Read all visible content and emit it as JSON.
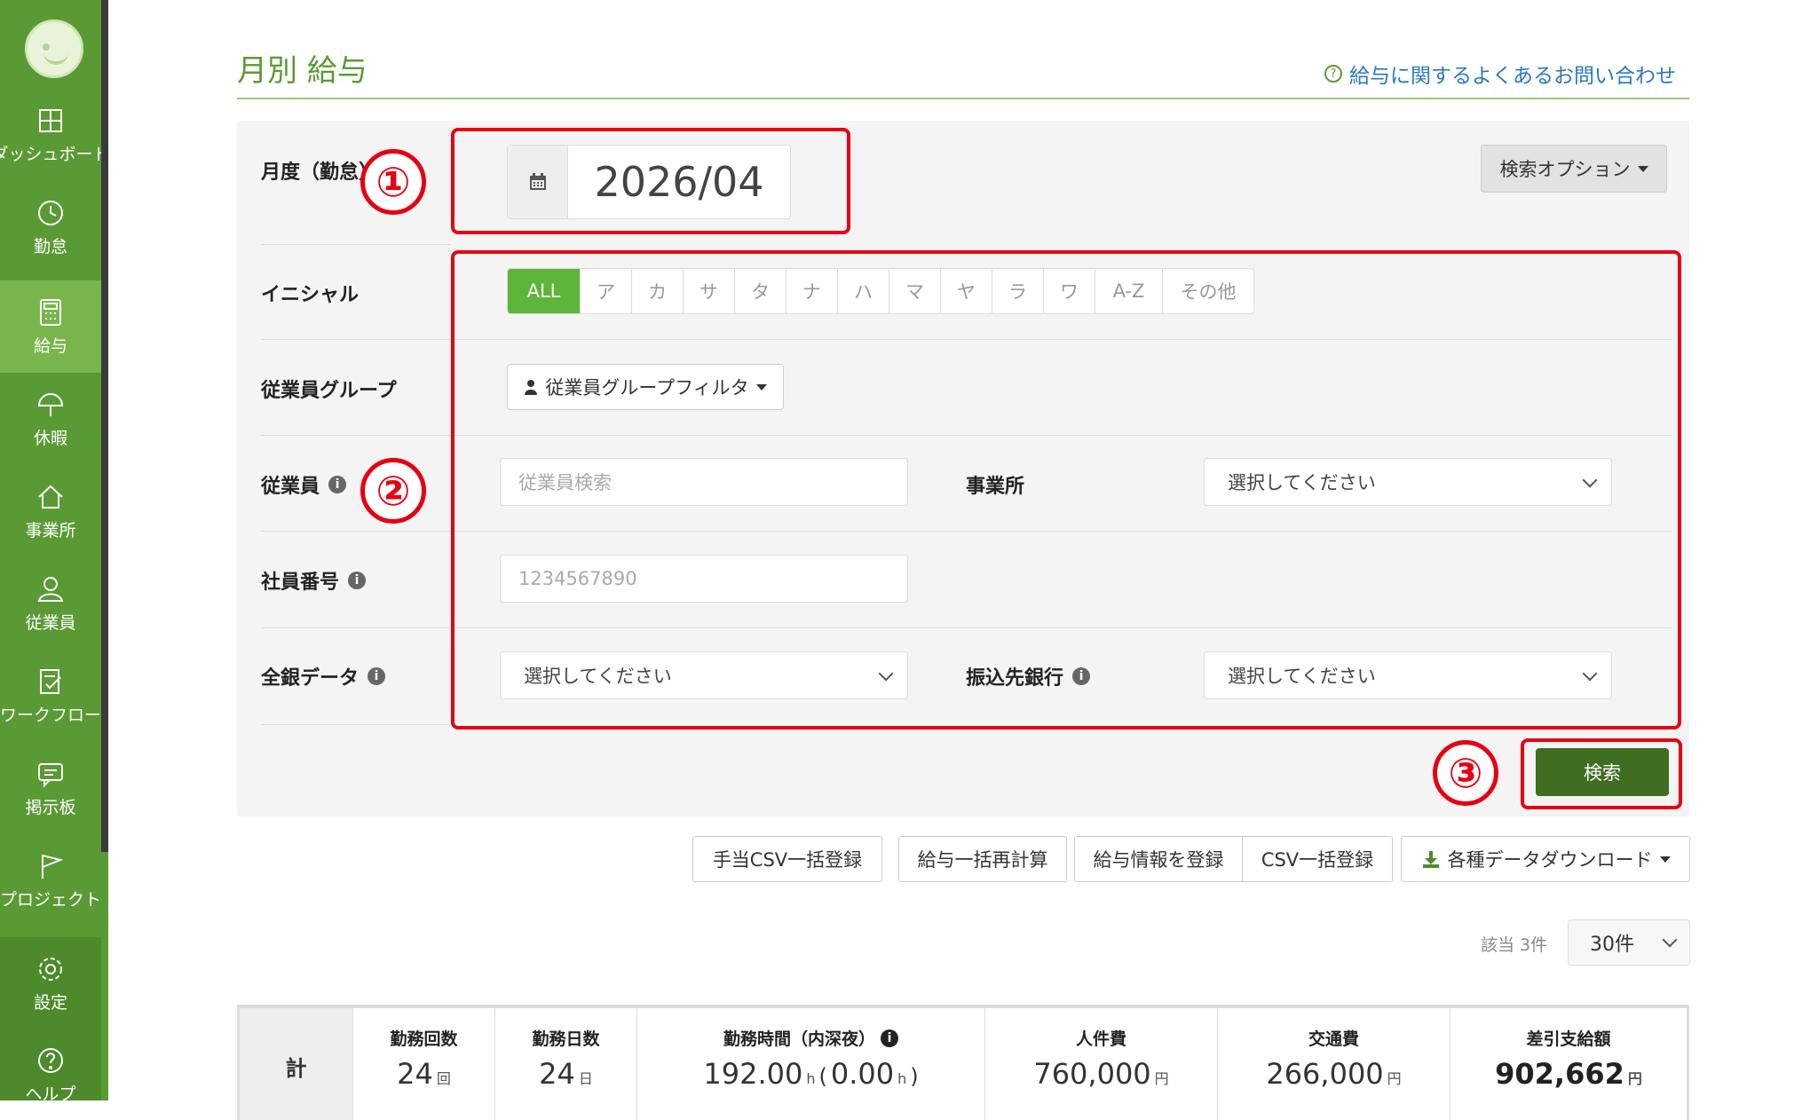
{
  "sidebar": {
    "items": [
      {
        "label": "ダッシュボード",
        "icon": "dashboard-icon"
      },
      {
        "label": "勤怠",
        "icon": "clock-icon"
      },
      {
        "label": "給与",
        "icon": "calculator-icon"
      },
      {
        "label": "休暇",
        "icon": "umbrella-icon"
      },
      {
        "label": "事業所",
        "icon": "home-icon"
      },
      {
        "label": "従業員",
        "icon": "person-icon"
      },
      {
        "label": "ワークフロー",
        "icon": "checklist-icon"
      },
      {
        "label": "掲示板",
        "icon": "chat-icon"
      },
      {
        "label": "プロジェクト",
        "icon": "flag-icon"
      },
      {
        "label": "設定",
        "icon": "gear-icon"
      },
      {
        "label": "ヘルプ",
        "icon": "help-icon"
      }
    ],
    "active": "給与"
  },
  "header": {
    "title": "月別 給与",
    "help_link": "給与に関するよくあるお問い合わせ"
  },
  "search": {
    "month_label": "月度（勤怠）",
    "month_value": "2026/04",
    "options_button": "検索オプション",
    "initial_label": "イニシャル",
    "initials": [
      "ALL",
      "ア",
      "カ",
      "サ",
      "タ",
      "ナ",
      "ハ",
      "マ",
      "ヤ",
      "ラ",
      "ワ",
      "A-Z",
      "その他"
    ],
    "group_label": "従業員グループ",
    "group_button": "従業員グループフィルタ",
    "employee_label": "従業員",
    "employee_placeholder": "従業員検索",
    "office_label": "事業所",
    "office_select": "選択してください",
    "emp_number_label": "社員番号",
    "emp_number_placeholder": "1234567890",
    "zengin_label": "全銀データ",
    "zengin_select": "選択してください",
    "bank_label": "振込先銀行",
    "bank_select": "選択してください",
    "search_button": "検索"
  },
  "annotations": [
    "①",
    "②",
    "③"
  ],
  "actions": {
    "allowance_csv": "手当CSV一括登録",
    "recalc": "給与一括再計算",
    "register": "給与情報を登録",
    "csv_register": "CSV一括登録",
    "download": "各種データダウンロード"
  },
  "results": {
    "count_label": "該当 3件",
    "per_page": "30件"
  },
  "summary": {
    "total_label": "計",
    "columns": [
      {
        "head": "勤務回数",
        "value": "24",
        "unit": "回"
      },
      {
        "head": "勤務日数",
        "value": "24",
        "unit": "日"
      },
      {
        "head": "勤務時間（内深夜）",
        "value": "192.00",
        "unit": "h",
        "sub_open": "(",
        "sub_value": "0.00",
        "sub_unit": "h",
        "sub_close": ")"
      },
      {
        "head": "人件費",
        "value": "760,000",
        "unit": "円"
      },
      {
        "head": "交通費",
        "value": "266,000",
        "unit": "円"
      },
      {
        "head": "差引支給額",
        "value": "902,662",
        "unit": "円"
      }
    ]
  },
  "colors": {
    "brand_green": "#5a9a34",
    "active_green": "#5db53a",
    "search_button": "#3f6d22",
    "annotation_red": "#e60012",
    "link_blue": "#2b78c2"
  }
}
